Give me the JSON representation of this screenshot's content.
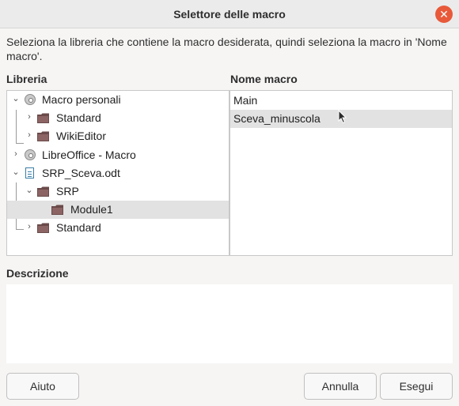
{
  "dialog": {
    "title": "Selettore delle macro",
    "close_icon": "close-icon"
  },
  "intro_text": "Seleziona la libreria che contiene la macro desiderata, quindi seleziona la macro in 'Nome macro'.",
  "library": {
    "label": "Libreria",
    "items": [
      {
        "label": "Macro personali",
        "icon": "disc-icon",
        "expanded": true
      },
      {
        "label": "Standard",
        "icon": "folder-icon",
        "expanded": false
      },
      {
        "label": "WikiEditor",
        "icon": "folder-icon",
        "expanded": false
      },
      {
        "label": "LibreOffice - Macro",
        "icon": "disc-icon",
        "expanded": false
      },
      {
        "label": "SRP_Sceva.odt",
        "icon": "document-icon",
        "expanded": true
      },
      {
        "label": "SRP",
        "icon": "folder-icon",
        "expanded": true
      },
      {
        "label": "Module1",
        "icon": "folder-icon",
        "selected": true
      },
      {
        "label": "Standard",
        "icon": "folder-icon",
        "expanded": false
      }
    ]
  },
  "macro_names": {
    "label": "Nome macro",
    "items": [
      {
        "label": "Main"
      },
      {
        "label": "Sceva_minuscola",
        "selected": true
      }
    ]
  },
  "description": {
    "label": "Descrizione",
    "text": ""
  },
  "buttons": {
    "help": "Aiuto",
    "cancel": "Annulla",
    "run": "Esegui"
  },
  "colors": {
    "close": "#e8593a",
    "selection": "#e2e2e2",
    "folder": "#6b4a4a"
  }
}
